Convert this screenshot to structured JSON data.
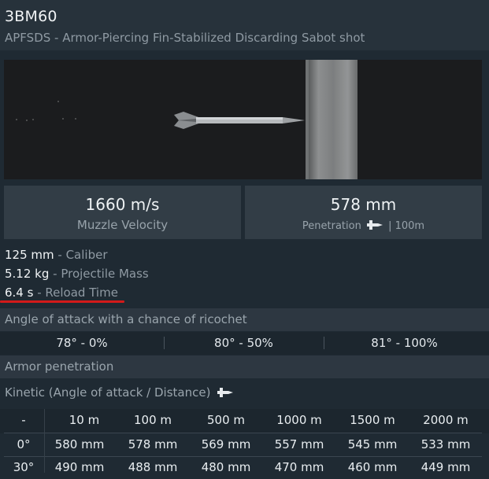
{
  "shell": {
    "name": "3BM60",
    "type": "APFSDS",
    "type_desc": "Armor-Piercing Fin-Stabilized Discarding Sabot shot"
  },
  "stats": {
    "velocity": {
      "value": "1660 m/s",
      "label": "Muzzle Velocity"
    },
    "penetration": {
      "value": "578 mm",
      "label": "Penetration",
      "distance": "| 100m",
      "icon": "shell-icon"
    }
  },
  "properties": [
    {
      "value": "125 mm",
      "label": "Caliber"
    },
    {
      "value": "5.12 kg",
      "label": "Projectile Mass"
    },
    {
      "value": "6.4 s",
      "label": "Reload Time"
    }
  ],
  "ricochet": {
    "title": "Angle of attack with a chance of ricochet",
    "items": [
      "78° - 0%",
      "80° - 50%",
      "81° - 100%"
    ]
  },
  "armor": {
    "title": "Armor penetration",
    "kinetic_label": "Kinetic (Angle of attack / Distance)",
    "headers": [
      "-",
      "10 m",
      "100 m",
      "500 m",
      "1000 m",
      "1500 m",
      "2000 m"
    ],
    "rows": [
      [
        "0°",
        "580 mm",
        "578 mm",
        "569 mm",
        "557 mm",
        "545 mm",
        "533 mm"
      ],
      [
        "30°",
        "490 mm",
        "488 mm",
        "480 mm",
        "470 mm",
        "460 mm",
        "449 mm"
      ]
    ]
  },
  "colors": {
    "accent_underline": "#d31a1a",
    "background": "#1f2a33"
  }
}
